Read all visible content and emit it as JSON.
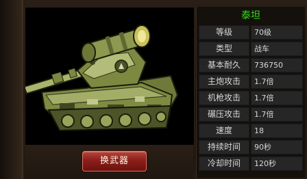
{
  "stats": {
    "title": "泰坦",
    "rows": [
      {
        "label": "等级",
        "value": "70级"
      },
      {
        "label": "类型",
        "value": "战车"
      },
      {
        "label": "基本耐久",
        "value": "736750"
      },
      {
        "label": "主炮攻击",
        "value": "1.7倍"
      },
      {
        "label": "机枪攻击",
        "value": "1.7倍"
      },
      {
        "label": "碾压攻击",
        "value": "1.7倍"
      },
      {
        "label": "速度",
        "value": "18"
      },
      {
        "label": "持续时间",
        "value": "90秒"
      },
      {
        "label": "冷却时间",
        "value": "120秒"
      }
    ]
  },
  "actions": {
    "swap_weapon_label": "换武器"
  },
  "colors": {
    "title_green": "#39d91c",
    "button_red": "#8c1f19",
    "tank_olive": "#8c9a4e"
  }
}
